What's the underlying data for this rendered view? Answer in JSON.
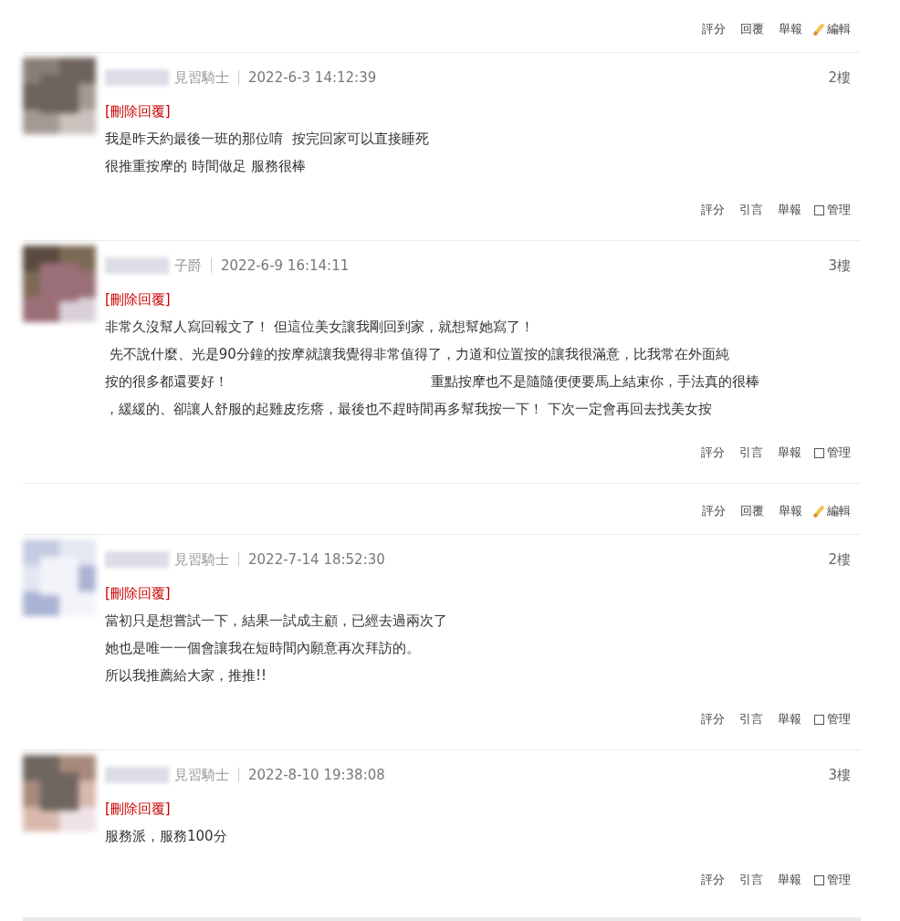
{
  "threads": [
    {
      "actions": [
        {
          "kind": "text",
          "label": "評分"
        },
        {
          "kind": "text",
          "label": "回覆"
        },
        {
          "kind": "text",
          "label": "舉報"
        },
        {
          "kind": "edit",
          "label": "編輯"
        }
      ],
      "replies": [
        {
          "rank": "見習騎士",
          "date": "2022-6-3 14:12:39",
          "floor": "2樓",
          "delete_link": "[刪除回覆]",
          "lines": [
            [
              "我是昨天約最後一班的那位唷  按完回家可以直接睡死"
            ],
            [
              "很推重按摩的 時間做足 服務很棒"
            ]
          ],
          "actions": [
            {
              "kind": "text",
              "label": "評分"
            },
            {
              "kind": "text",
              "label": "引言"
            },
            {
              "kind": "text",
              "label": "舉報"
            },
            {
              "kind": "manage",
              "label": "管理",
              "checked": false
            }
          ]
        },
        {
          "rank": "子爵",
          "date": "2022-6-9 16:14:11",
          "floor": "3樓",
          "delete_link": "[刪除回覆]",
          "lines": [
            [
              "非常久沒幫人寫回報文了！ 但這位美女讓我剛回到家，就想幫她寫了！"
            ],
            [
              " 先不說什麼、光是90分鐘的按摩就讓我覺得非常值得了，力道和位置按的讓我很滿意，比我常在外面純"
            ],
            [
              "按的很多都還要好！",
              "重點按摩也不是隨隨便便要馬上結束你，手法真的很棒"
            ],
            [
              "，緩緩的、卻讓人舒服的起雞皮疙瘩，最後也不趕時間再多幫我按一下！ 下次一定會再回去找美女按"
            ]
          ],
          "actions": [
            {
              "kind": "text",
              "label": "評分"
            },
            {
              "kind": "text",
              "label": "引言"
            },
            {
              "kind": "text",
              "label": "舉報"
            },
            {
              "kind": "manage",
              "label": "管理",
              "checked": false
            }
          ]
        }
      ]
    },
    {
      "actions": [
        {
          "kind": "text",
          "label": "評分"
        },
        {
          "kind": "text",
          "label": "回覆"
        },
        {
          "kind": "text",
          "label": "舉報"
        },
        {
          "kind": "edit",
          "label": "編輯"
        }
      ],
      "replies": [
        {
          "rank": "見習騎士",
          "date": "2022-7-14 18:52:30",
          "floor": "2樓",
          "delete_link": "[刪除回覆]",
          "lines": [
            [
              "當初只是想嘗試一下，結果一試成主顧，已經去過兩次了"
            ],
            [
              "她也是唯一一個會讓我在短時間內願意再次拜訪的。"
            ],
            [
              "所以我推薦給大家，推推!!"
            ]
          ],
          "actions": [
            {
              "kind": "text",
              "label": "評分"
            },
            {
              "kind": "text",
              "label": "引言"
            },
            {
              "kind": "text",
              "label": "舉報"
            },
            {
              "kind": "manage",
              "label": "管理",
              "checked": false
            }
          ]
        },
        {
          "rank": "見習騎士",
          "date": "2022-8-10 19:38:08",
          "floor": "3樓",
          "delete_link": "[刪除回覆]",
          "lines": [
            [
              "服務派，服務100分"
            ]
          ],
          "actions": [
            {
              "kind": "text",
              "label": "評分"
            },
            {
              "kind": "text",
              "label": "引言"
            },
            {
              "kind": "text",
              "label": "舉報"
            },
            {
              "kind": "manage",
              "label": "管理",
              "checked": false
            }
          ]
        }
      ]
    }
  ]
}
